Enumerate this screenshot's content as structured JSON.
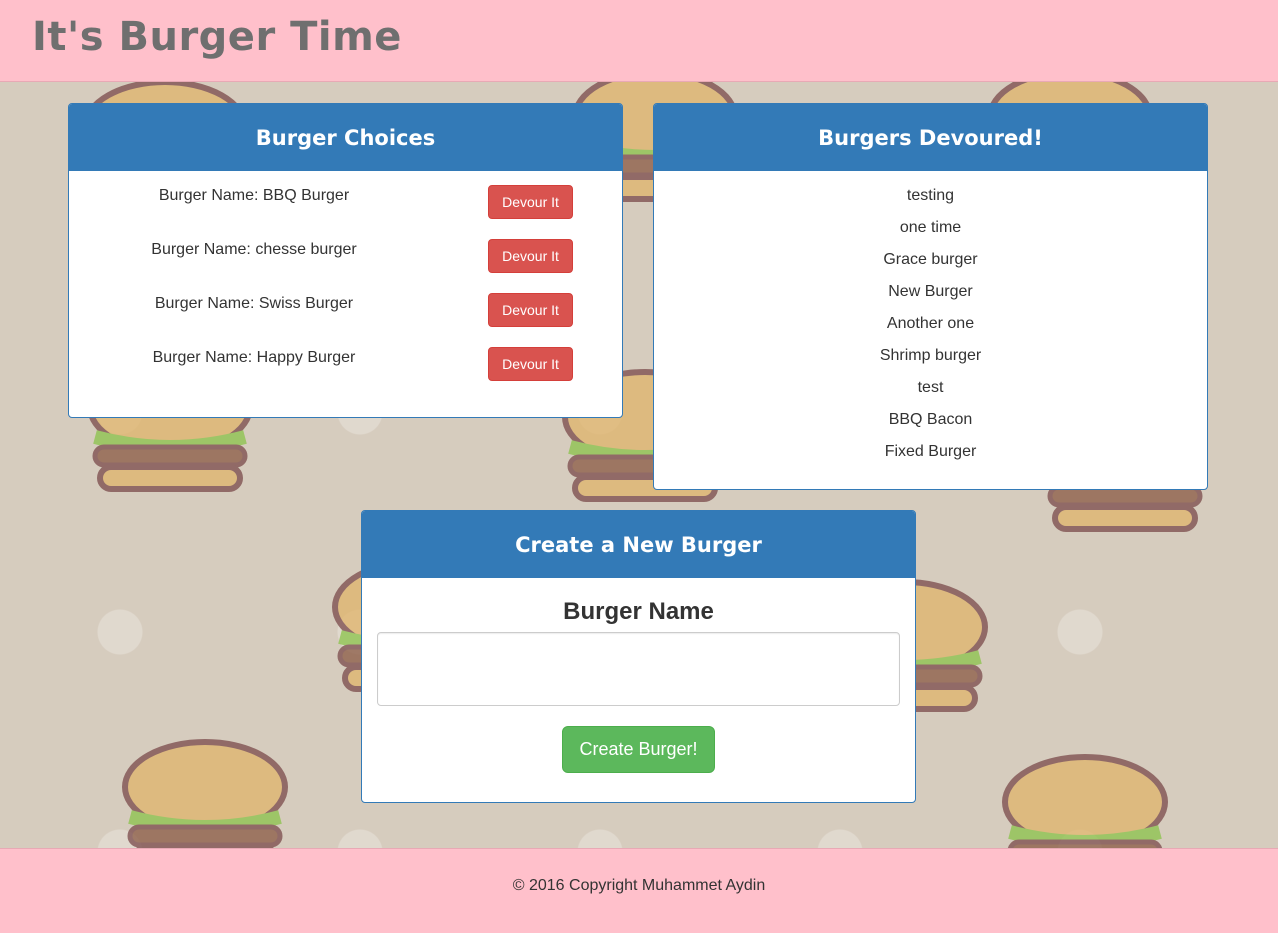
{
  "header": {
    "title": "It's Burger Time"
  },
  "choices": {
    "heading": "Burger Choices",
    "items": [
      {
        "label": "Burger Name: BBQ Burger",
        "button": "Devour It"
      },
      {
        "label": "Burger Name: chesse burger",
        "button": "Devour It"
      },
      {
        "label": "Burger Name: Swiss Burger",
        "button": "Devour It"
      },
      {
        "label": "Burger Name: Happy Burger",
        "button": "Devour It"
      }
    ]
  },
  "devoured": {
    "heading": "Burgers Devoured!",
    "items": [
      "testing",
      "one time",
      "Grace burger",
      "New Burger",
      "Another one",
      "Shrimp burger",
      "test",
      "BBQ Bacon",
      "Fixed Burger"
    ]
  },
  "create": {
    "heading": "Create a New Burger",
    "label": "Burger Name",
    "input_value": "",
    "button": "Create Burger!"
  },
  "footer": {
    "copyright": "© 2016 Copyright Muhammet Aydin"
  },
  "colors": {
    "header_bg": "#ffc0cb",
    "panel_primary": "#337ab7",
    "danger": "#d9534f",
    "success": "#5cb85c"
  }
}
